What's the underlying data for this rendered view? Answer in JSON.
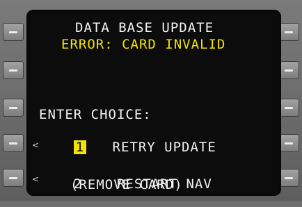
{
  "screen": {
    "title": "DATA BASE UPDATE",
    "error": "ERROR: CARD INVALID",
    "prompt": "ENTER CHOICE:",
    "options": [
      {
        "number": "1",
        "label": "RETRY UPDATE",
        "selected": true
      },
      {
        "number": "2",
        "label": "RESTART NAV",
        "sublabel": "(REMOVE CARD)",
        "selected": false
      }
    ],
    "caret_glyph": "<"
  },
  "colors": {
    "text": "#f2f2f2",
    "accent": "#f2e400",
    "screen_bg": "#0c0c0c",
    "bezel": "#6f6f6f"
  },
  "icons": {
    "line_select_key": "dash-bar-icon"
  }
}
